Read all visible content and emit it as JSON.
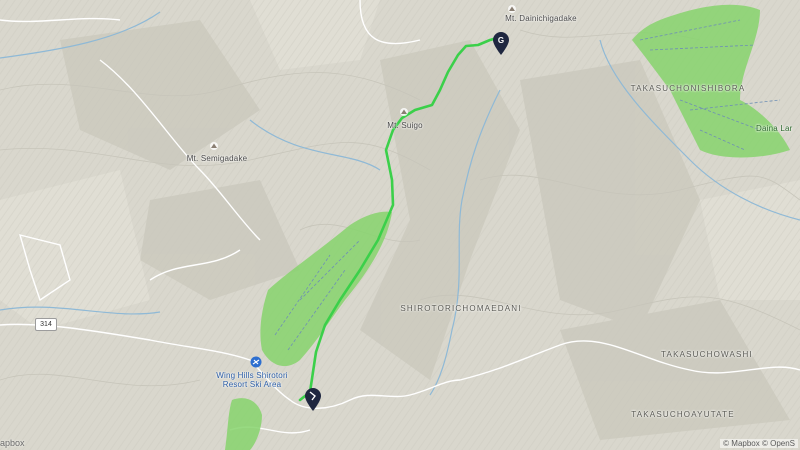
{
  "map": {
    "labels": {
      "mt_dainichigadake": "Mt. Dainichigadake",
      "mt_suigo": "Mt. Suigo",
      "mt_semigadake": "Mt. Semigadake",
      "takasuchonishibora": "TAKASUCHONISHIBORA",
      "daina_lar": "Daina Lar",
      "shirotorichomaedani": "SHIROTORICHOMAEDANI",
      "takasuchowashi": "TAKASUCHOWASHI",
      "takasuchoayutate": "TAKASUCHOAYUTATE",
      "resort_line1": "Wing Hills Shirotori",
      "resort_line2": "Resort Ski Area",
      "route_shield": "314"
    },
    "attribution_left": "apbox",
    "attribution_right": "© Mapbox © OpenS",
    "markers": {
      "goal_letter": "G"
    },
    "colors": {
      "terrain": "#d9d7cd",
      "route": "#3bd04a",
      "ski_area": "#86d46c",
      "road": "#ffffff",
      "water": "#8fb9d6",
      "marker": "#1f2740"
    }
  }
}
